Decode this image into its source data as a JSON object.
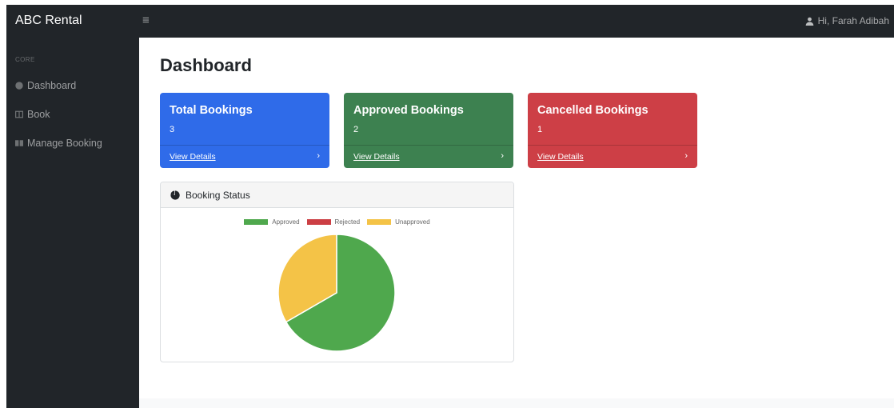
{
  "app": {
    "brand": "ABC Rental",
    "menu_icon": "≡",
    "user_greeting": "Hi, Farah Adibah"
  },
  "sidebar": {
    "heading": "CORE",
    "items": [
      {
        "label": "Dashboard",
        "icon": "dashboard-icon"
      },
      {
        "label": "Book",
        "icon": "book-icon"
      },
      {
        "label": "Manage Booking",
        "icon": "manage-booking-icon"
      }
    ]
  },
  "page": {
    "title": "Dashboard"
  },
  "cards": [
    {
      "title": "Total Bookings",
      "value": "3",
      "link": "View Details",
      "color": "#2f6be9"
    },
    {
      "title": "Approved Bookings",
      "value": "2",
      "link": "View Details",
      "color": "#3d8150"
    },
    {
      "title": "Cancelled Bookings",
      "value": "1",
      "link": "View Details",
      "color": "#cd3f46"
    }
  ],
  "chart_panel": {
    "title": "Booking Status",
    "icon": "pie-chart-icon"
  },
  "chart_data": {
    "type": "pie",
    "labels": [
      "Approved",
      "Rejected",
      "Unapproved"
    ],
    "values": [
      2,
      0,
      1
    ],
    "colors": [
      "#4fa84d",
      "#cc3f44",
      "#f4c347"
    ],
    "legend": "top"
  }
}
